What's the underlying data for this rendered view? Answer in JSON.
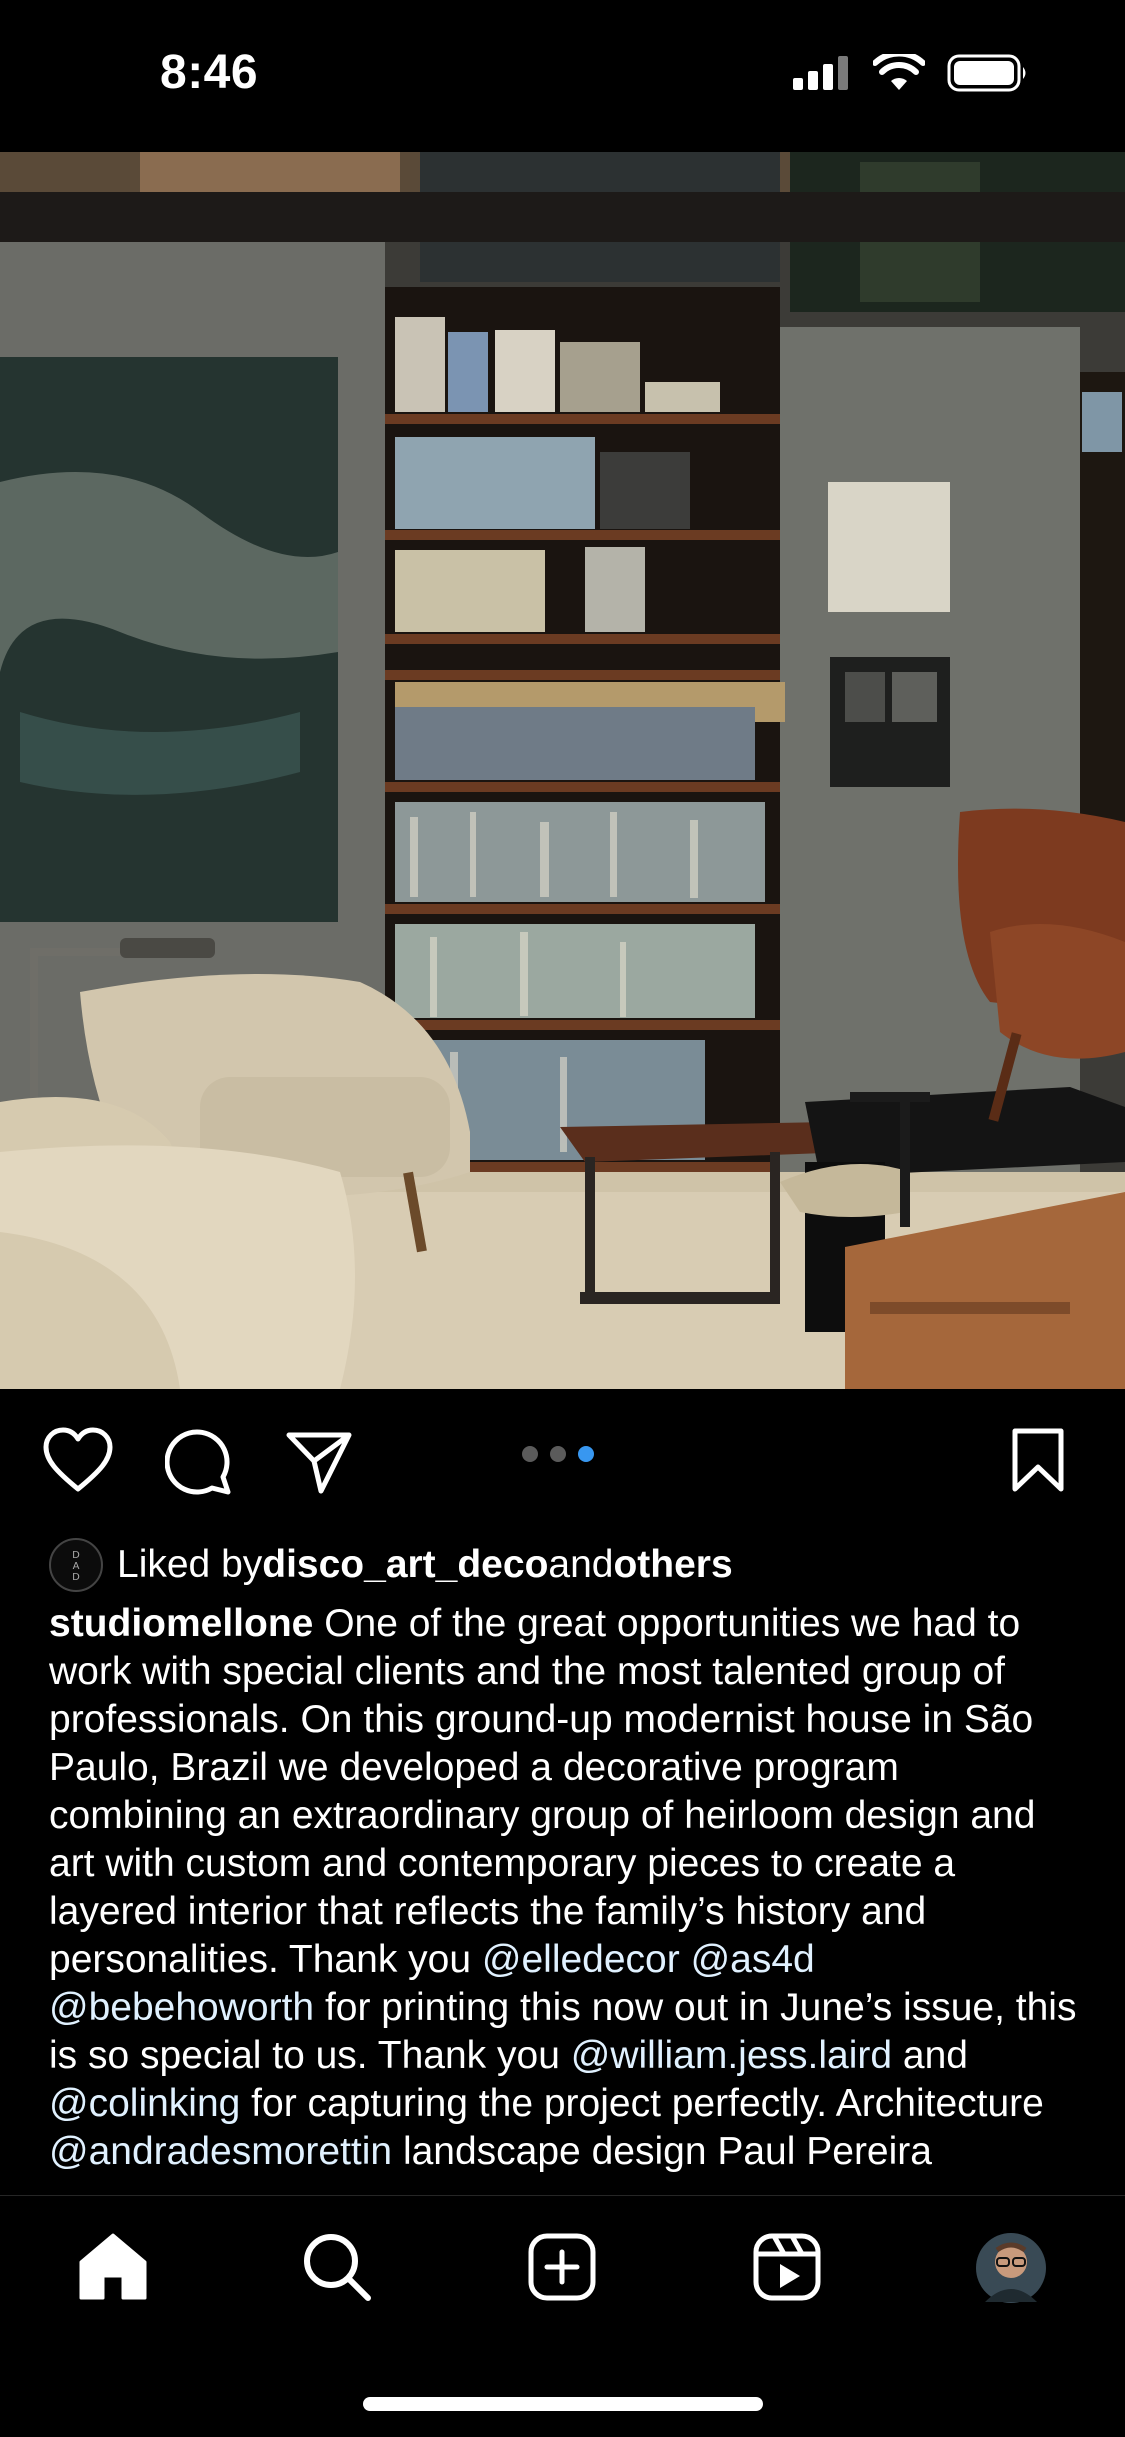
{
  "status_bar": {
    "time": "8:46",
    "icons": [
      "cellular-signal-icon",
      "wifi-icon",
      "battery-icon"
    ]
  },
  "post": {
    "image_alt": "Living room interior with bookshelves, armchairs and art",
    "carousel": {
      "count": 3,
      "active_index": 2,
      "active_color": "#3897f0",
      "inactive_color": "#5b5b5b"
    },
    "actions": [
      "heart-icon",
      "comment-icon",
      "share-icon",
      "bookmark-icon"
    ],
    "liked_by": {
      "prefix": "Liked by ",
      "user": "disco_art_deco",
      "middle": " and ",
      "others": "others",
      "avatar_letters": "DAD"
    },
    "caption": {
      "username": "studiomellone",
      "text_1": " One of the great opportunities we had to work with special clients and the most talented group of professionals. On this ground-up modernist house in São Paulo, Brazil we developed a decorative program combining an extraordinary group of heirloom design and art with custom and contemporary pieces to create a layered interior that reflects the family’s history and personalities. Thank you ",
      "mention_1": "@elledecor",
      "sep_1": " ",
      "mention_2": "@as4d",
      "sep_2": " ",
      "mention_3": "@bebehoworth",
      "text_2": " for printing this now out in June’s issue, this is so special to us. Thank you ",
      "mention_4": "@william.jess.laird",
      "text_3": " and ",
      "mention_5": "@colinking",
      "text_4": " for capturing the project perfectly.  Architecture ",
      "mention_6": "@andradesmorettin",
      "text_5": " landscape design Paul Pereira"
    }
  },
  "bottom_nav": {
    "items": [
      "home-icon",
      "search-icon",
      "create-icon",
      "reels-icon",
      "profile-avatar"
    ],
    "active": "home-icon"
  }
}
